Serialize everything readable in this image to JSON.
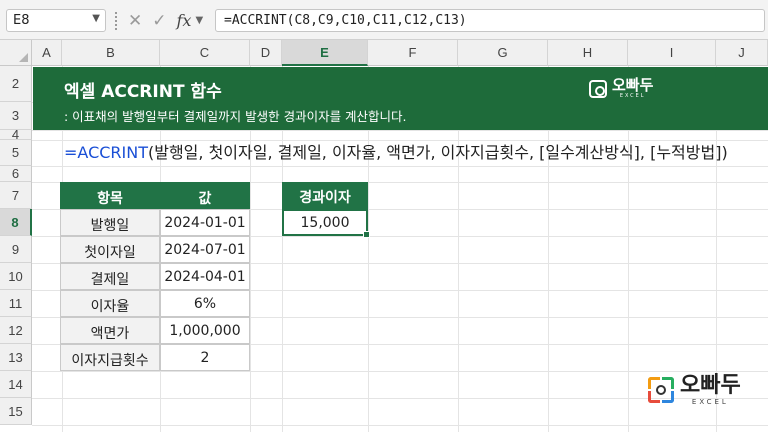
{
  "formula_bar": {
    "name_box": "E8",
    "formula": "=ACCRINT(C8,C9,C10,C11,C12,C13)",
    "icons": [
      "cancel-icon",
      "enter-check-icon",
      "insert-function-icon"
    ],
    "fx_label": "fx"
  },
  "columns": [
    "A",
    "B",
    "C",
    "D",
    "E",
    "F",
    "G",
    "H",
    "I",
    "J"
  ],
  "rows": [
    "2",
    "3",
    "4",
    "5",
    "6",
    "7",
    "8",
    "9",
    "10",
    "11",
    "12",
    "13",
    "14",
    "15"
  ],
  "selected": {
    "column": "E",
    "row": "8"
  },
  "banner": {
    "title": "엑셀 ACCRINT 함수",
    "subtitle": ": 이표채의 발행일부터 결제일까지 발생한 경과이자를 계산합니다.",
    "logo_text": "오빠두",
    "logo_sub": "EXCEL"
  },
  "syntax": {
    "fn": "=ACCRINT",
    "args": "(발행일, 첫이자일, 결제일, 이자율, 액면가, 이자지급횟수, [일수계산방식], [누적방법])"
  },
  "table": {
    "headers": [
      "항목",
      "값"
    ],
    "rows": [
      [
        "발행일",
        "2024-01-01"
      ],
      [
        "첫이자일",
        "2024-07-01"
      ],
      [
        "결제일",
        "2024-04-01"
      ],
      [
        "이자율",
        "6%"
      ],
      [
        "액면가",
        "1,000,000"
      ],
      [
        "이자지급횟수",
        "2"
      ]
    ]
  },
  "result": {
    "header": "경과이자",
    "value": "15,000"
  },
  "footer_logo": {
    "text": "오빠두",
    "sub": "EXCEL"
  },
  "colors": {
    "excel_green": "#217346",
    "banner_green": "#1e6b3a",
    "function_blue": "#1a4fd6"
  }
}
